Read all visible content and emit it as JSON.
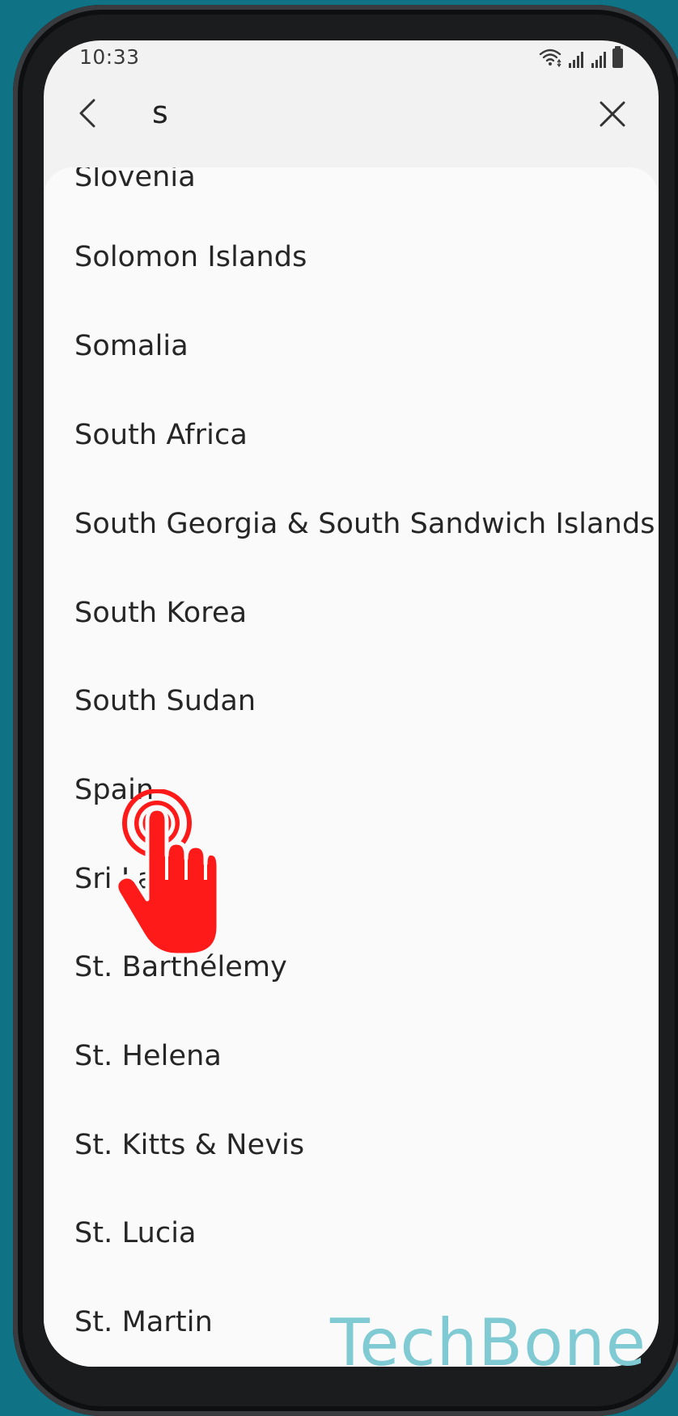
{
  "status_bar": {
    "time": "10:33",
    "icons": [
      "wifi-icon",
      "signal-icon",
      "signal-icon",
      "battery-icon"
    ]
  },
  "search": {
    "query": "s",
    "back_icon": "chevron-left-icon",
    "clear_icon": "close-icon"
  },
  "countries": [
    "Slovenia",
    "Solomon Islands",
    "Somalia",
    "South Africa",
    "South Georgia & South Sandwich Islands",
    "South Korea",
    "South Sudan",
    "Spain",
    "Sri Lanka",
    "St. Barthélemy",
    "St. Helena",
    "St. Kitts & Nevis",
    "St. Lucia",
    "St. Martin"
  ],
  "watermark": "TechBone",
  "colors": {
    "background": "#0f7385",
    "touch_indicator": "#ff1a1a",
    "watermark": "#7fcad3"
  }
}
